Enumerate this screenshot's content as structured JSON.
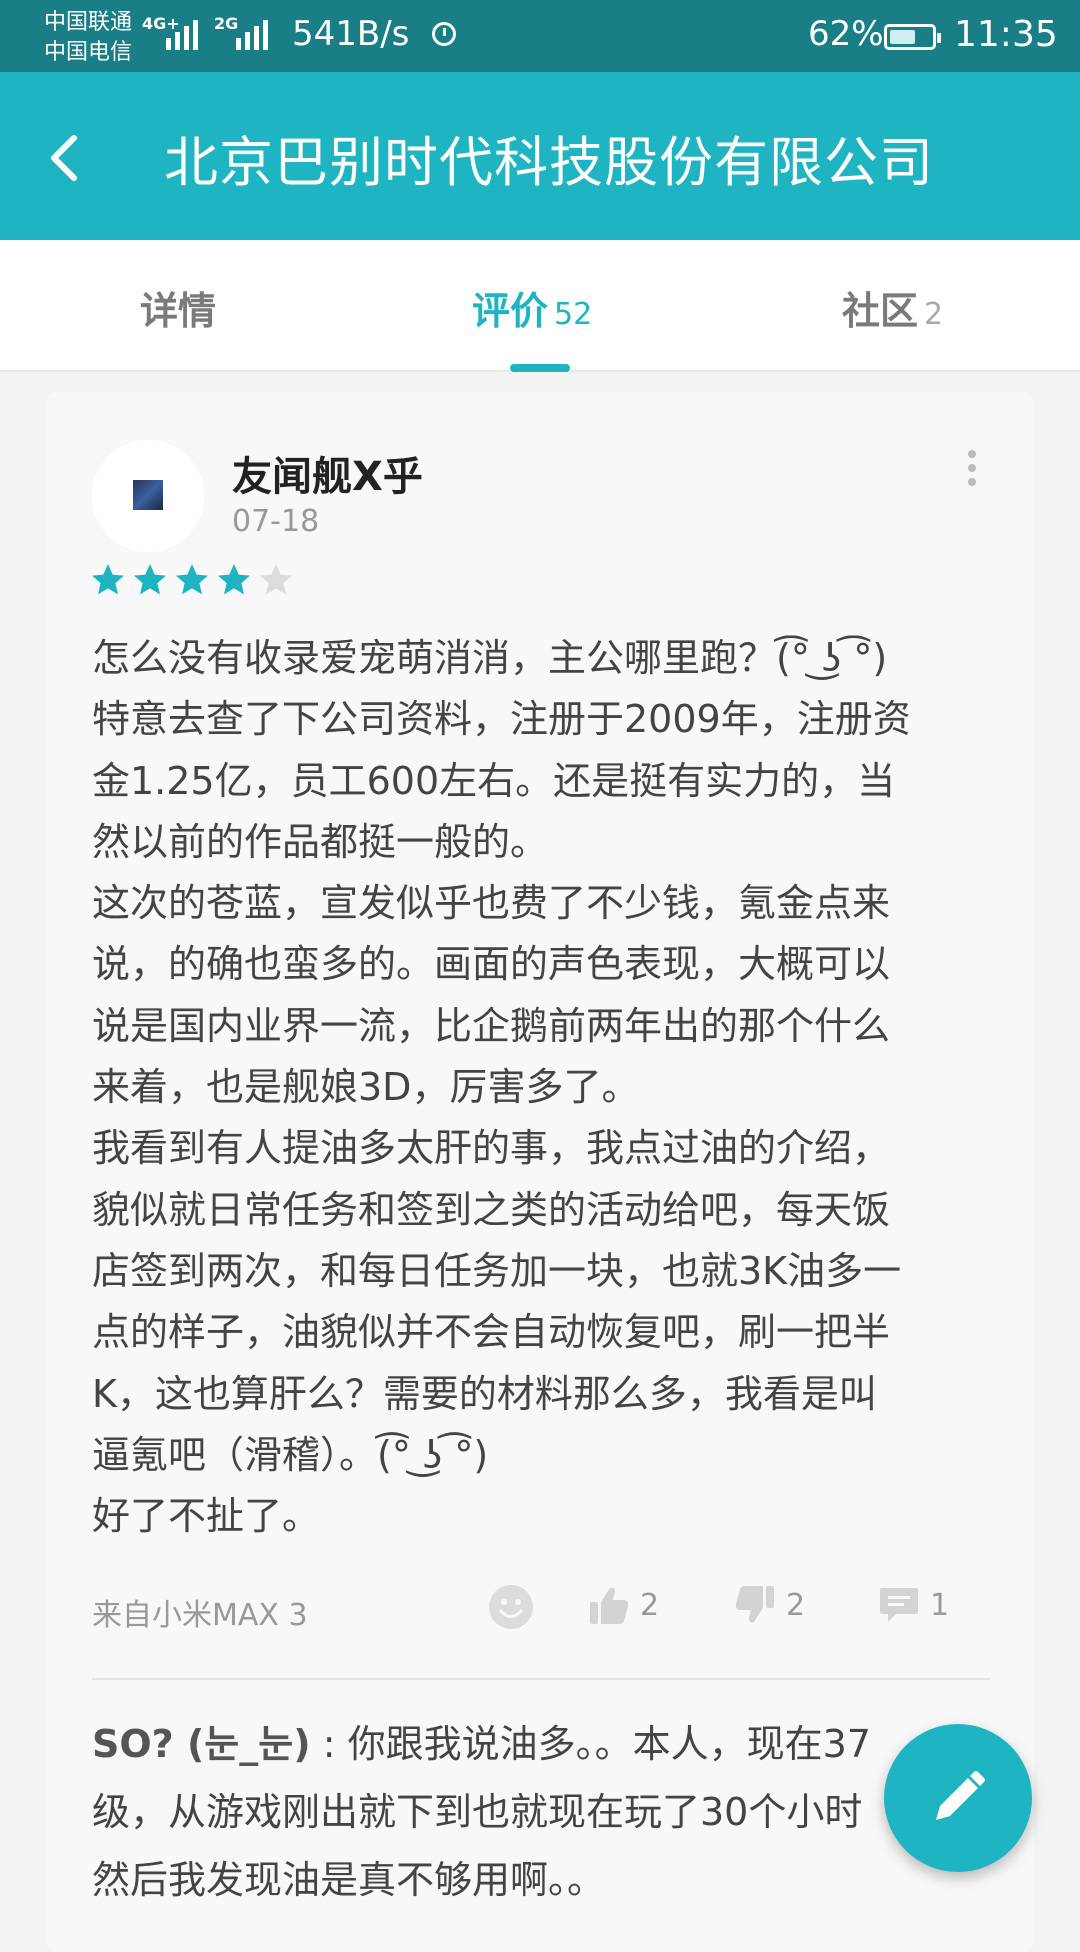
{
  "status_bar": {
    "carrier_1": "中国联通",
    "carrier_2": "中国电信",
    "signal_1": "4G+",
    "signal_2": "2G",
    "net_speed": "541B/s",
    "battery": "62%",
    "battery_level": 0.62,
    "time": "11:35"
  },
  "app_bar": {
    "title": "北京巴别时代科技股份有限公司"
  },
  "tabs": [
    {
      "label": "详情",
      "count": ""
    },
    {
      "label": "评价",
      "count": "52"
    },
    {
      "label": "社区",
      "count": "2"
    }
  ],
  "review": {
    "user": "友闻舰X乎",
    "date": "07-18",
    "rating": 4,
    "rating_max": 5,
    "lines": [
      "怎么没有收录爱宠萌消消，主公哪里跑？(͡° ͜ʖ ͡°)",
      "特意去查了下公司资料，注册于2009年，注册资",
      "金1.25亿，员工600左右。还是挺有实力的，当",
      "然以前的作品都挺一般的。",
      "这次的苍蓝，宣发似乎也费了不少钱，氪金点来",
      "说，的确也蛮多的。画面的声色表现，大概可以",
      "说是国内业界一流，比企鹅前两年出的那个什么",
      "来着，也是舰娘3D，厉害多了。",
      "我看到有人提油多太肝的事，我点过油的介绍，",
      "貌似就日常任务和签到之类的活动给吧，每天饭",
      "店签到两次，和每日任务加一块，也就3K油多一",
      "点的样子，油貌似并不会自动恢复吧，刷一把半",
      "K，这也算肝么？需要的材料那么多，我看是叫",
      "逼氪吧（滑稽）。(͡° ͜ʖ ͡°)",
      "好了不扯了。"
    ],
    "device": "来自小米MAX 3",
    "likes": "2",
    "dislikes": "2",
    "replies": "1"
  },
  "reply": {
    "author": "SO? (눈_눈)",
    "separator": ":",
    "lines": [
      "你跟我说油多。。本人，现在37",
      "级，从游戏刚出就下到也就现在玩了30个小时",
      "然后我发现油是真不够用啊。。"
    ]
  },
  "colors": {
    "accent": "#1fb4c2",
    "status_bar": "#1a7e87"
  }
}
